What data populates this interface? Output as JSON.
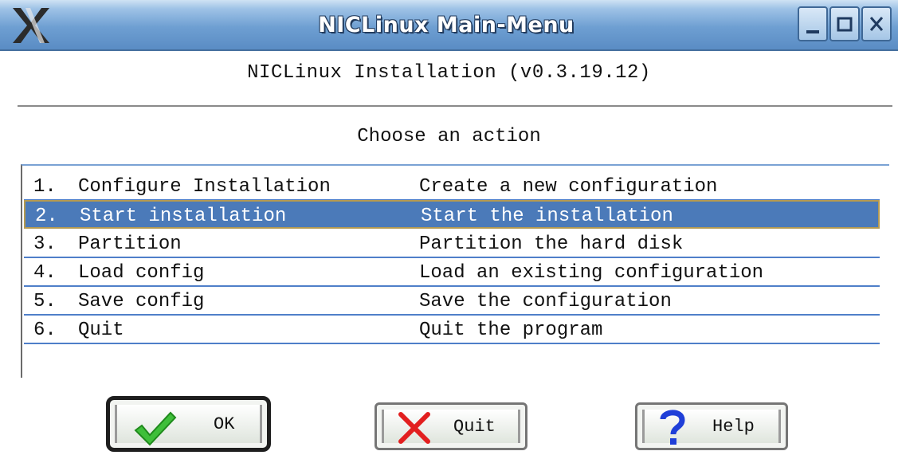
{
  "window": {
    "title": "NICLinux Main-Menu",
    "logo_icon": "x-window-logo-icon",
    "controls": [
      "minimize-icon",
      "maximize-icon",
      "close-icon"
    ]
  },
  "heading": "NICLinux Installation (v0.3.19.12)",
  "prompt": "Choose an action",
  "menu": {
    "selected_index": 1,
    "items": [
      {
        "num": "1.",
        "name": "Configure Installation",
        "desc": "Create a new configuration"
      },
      {
        "num": "2.",
        "name": "Start installation",
        "desc": "Start the installation"
      },
      {
        "num": "3.",
        "name": "Partition",
        "desc": "Partition the hard disk"
      },
      {
        "num": "4.",
        "name": "Load config",
        "desc": "Load an existing configuration"
      },
      {
        "num": "5.",
        "name": "Save config",
        "desc": "Save the configuration"
      },
      {
        "num": "6.",
        "name": "Quit",
        "desc": "Quit the program"
      }
    ]
  },
  "buttons": {
    "ok": {
      "label": "OK",
      "icon": "checkmark-icon"
    },
    "quit": {
      "label": "Quit",
      "icon": "red-x-icon"
    },
    "help": {
      "label": "Help",
      "icon": "question-mark-icon"
    }
  },
  "colors": {
    "selection": "#4b7ab9",
    "row_separator": "#4f7fc9",
    "title_bar": "#6e9fd2"
  }
}
